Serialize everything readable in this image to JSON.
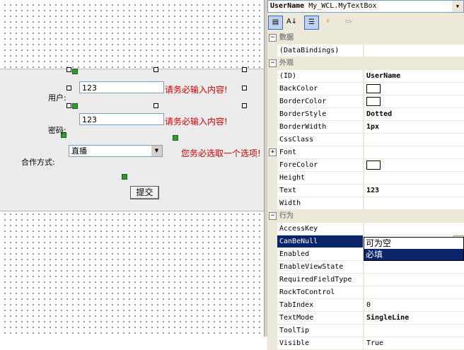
{
  "designer": {
    "user_label": "用户:",
    "password_label": "密码:",
    "coop_label": "合作方式:",
    "user_value": "123",
    "password_value": "123",
    "user_error": "请务必输入内容!",
    "password_error": "请务必输入内容!",
    "coop_value": "直播",
    "coop_error": "您务必选取一个选项!",
    "submit_label": "提交"
  },
  "properties": {
    "object_name": "UserName",
    "object_type": "My_WCL.MyTextBox",
    "colors": {
      "selected": "#0a246a",
      "error_text": "#d40000"
    },
    "categories": {
      "data": "数据",
      "appearance": "外观",
      "behavior": "行为"
    },
    "rows": {
      "databindings": {
        "name": "(DataBindings)",
        "value": ""
      },
      "id": {
        "name": "(ID)",
        "value": "UserName"
      },
      "backcolor": {
        "name": "BackColor",
        "value": ""
      },
      "bordercolor": {
        "name": "BorderColor",
        "value": ""
      },
      "borderstyle": {
        "name": "BorderStyle",
        "value": "Dotted"
      },
      "borderwidth": {
        "name": "BorderWidth",
        "value": "1px"
      },
      "cssclass": {
        "name": "CssClass",
        "value": ""
      },
      "font": {
        "name": "Font",
        "value": ""
      },
      "forecolor": {
        "name": "ForeColor",
        "value": ""
      },
      "height": {
        "name": "Height",
        "value": ""
      },
      "text": {
        "name": "Text",
        "value": "123"
      },
      "width": {
        "name": "Width",
        "value": ""
      },
      "accesskey": {
        "name": "AccessKey",
        "value": ""
      },
      "canbenull": {
        "name": "CanBeNull",
        "value": "必填"
      },
      "enabled": {
        "name": "Enabled",
        "value": ""
      },
      "enableviewstate": {
        "name": "EnableViewState",
        "value": ""
      },
      "requiredfieldtype": {
        "name": "RequiredFieldType",
        "value": ""
      },
      "rocktocontrol": {
        "name": "RockToControl",
        "value": ""
      },
      "tabindex": {
        "name": "TabIndex",
        "value": "0"
      },
      "textmode": {
        "name": "TextMode",
        "value": "SingleLine"
      },
      "tooltip": {
        "name": "ToolTip",
        "value": ""
      },
      "visible": {
        "name": "Visible",
        "value": "True"
      }
    },
    "canbenull_options": [
      "可为空",
      "必填"
    ]
  }
}
